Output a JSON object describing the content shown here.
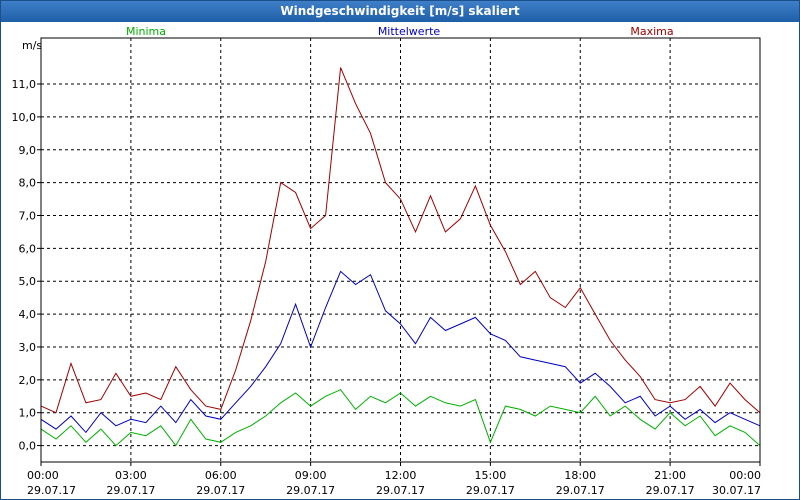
{
  "window": {
    "title": "Windgeschwindigkeit [m/s] skaliert"
  },
  "chart_data": {
    "type": "line",
    "title": "Windgeschwindigkeit [m/s] skaliert",
    "ylabel": "m/s",
    "xlabel": "",
    "ylim": [
      -0.5,
      12.4
    ],
    "xlim": [
      0,
      24
    ],
    "grid": true,
    "legend": "top",
    "y_ticks": [
      0,
      1,
      2,
      3,
      4,
      5,
      6,
      7,
      8,
      9,
      10,
      11
    ],
    "y_tick_labels": [
      "0,0",
      "1,0",
      "2,0",
      "3,0",
      "4,0",
      "5,0",
      "6,0",
      "7,0",
      "8,0",
      "9,0",
      "10,0",
      "11,0"
    ],
    "x_ticks": [
      {
        "x": 0,
        "time": "00:00",
        "date": "29.07.17"
      },
      {
        "x": 3,
        "time": "03:00",
        "date": "29.07.17"
      },
      {
        "x": 6,
        "time": "06:00",
        "date": "29.07.17"
      },
      {
        "x": 9,
        "time": "09:00",
        "date": "29.07.17"
      },
      {
        "x": 12,
        "time": "12:00",
        "date": "29.07.17"
      },
      {
        "x": 15,
        "time": "15:00",
        "date": "29.07.17"
      },
      {
        "x": 18,
        "time": "18:00",
        "date": "29.07.17"
      },
      {
        "x": 21,
        "time": "21:00",
        "date": "29.07.17"
      },
      {
        "x": 24,
        "time": "00:00",
        "date": "30.07.17"
      }
    ],
    "series": [
      {
        "name": "Minima",
        "color": "#00b000",
        "x": [
          0,
          0.5,
          1,
          1.5,
          2,
          2.5,
          3,
          3.5,
          4,
          4.5,
          5,
          5.5,
          6,
          6.5,
          7,
          7.5,
          8,
          8.5,
          9,
          9.5,
          10,
          10.5,
          11,
          11.5,
          12,
          12.5,
          13,
          13.5,
          14,
          14.5,
          15,
          15.5,
          16,
          16.5,
          17,
          17.5,
          18,
          18.5,
          19,
          19.5,
          20,
          20.5,
          21,
          21.5,
          22,
          22.5,
          23,
          23.5,
          24
        ],
        "values": [
          0.5,
          0.2,
          0.6,
          0.1,
          0.5,
          0.0,
          0.4,
          0.3,
          0.6,
          0.0,
          0.8,
          0.2,
          0.1,
          0.4,
          0.6,
          0.9,
          1.3,
          1.6,
          1.2,
          1.5,
          1.7,
          1.1,
          1.5,
          1.3,
          1.6,
          1.2,
          1.5,
          1.3,
          1.2,
          1.4,
          0.1,
          1.2,
          1.1,
          0.9,
          1.2,
          1.1,
          1.0,
          1.5,
          0.9,
          1.2,
          0.8,
          0.5,
          1.0,
          0.6,
          0.9,
          0.3,
          0.6,
          0.4,
          0.0
        ]
      },
      {
        "name": "Mittelwerte",
        "color": "#0000c0",
        "x": [
          0,
          0.5,
          1,
          1.5,
          2,
          2.5,
          3,
          3.5,
          4,
          4.5,
          5,
          5.5,
          6,
          6.5,
          7,
          7.5,
          8,
          8.5,
          9,
          9.5,
          10,
          10.5,
          11,
          11.5,
          12,
          12.5,
          13,
          13.5,
          14,
          14.5,
          15,
          15.5,
          16,
          16.5,
          17,
          17.5,
          18,
          18.5,
          19,
          19.5,
          20,
          20.5,
          21,
          21.5,
          22,
          22.5,
          23,
          23.5,
          24
        ],
        "values": [
          0.8,
          0.5,
          0.9,
          0.4,
          1.0,
          0.6,
          0.8,
          0.7,
          1.2,
          0.7,
          1.4,
          0.9,
          0.8,
          1.3,
          1.8,
          2.4,
          3.1,
          4.3,
          3.0,
          4.2,
          5.3,
          4.9,
          5.2,
          4.1,
          3.7,
          3.1,
          3.9,
          3.5,
          3.7,
          3.9,
          3.4,
          3.2,
          2.7,
          2.6,
          2.5,
          2.4,
          1.9,
          2.2,
          1.8,
          1.3,
          1.5,
          0.9,
          1.2,
          0.8,
          1.1,
          0.7,
          1.0,
          0.8,
          0.6
        ]
      },
      {
        "name": "Maxima",
        "color": "#a00000",
        "x": [
          0,
          0.5,
          1,
          1.5,
          2,
          2.5,
          3,
          3.5,
          4,
          4.5,
          5,
          5.5,
          6,
          6.5,
          7,
          7.5,
          8,
          8.5,
          9,
          9.5,
          10,
          10.5,
          11,
          11.5,
          12,
          12.5,
          13,
          13.5,
          14,
          14.5,
          15,
          15.5,
          16,
          16.5,
          17,
          17.5,
          18,
          18.5,
          19,
          19.5,
          20,
          20.5,
          21,
          21.5,
          22,
          22.5,
          23,
          23.5,
          24
        ],
        "values": [
          1.2,
          1.0,
          2.5,
          1.3,
          1.4,
          2.2,
          1.5,
          1.6,
          1.4,
          2.4,
          1.7,
          1.2,
          1.1,
          2.3,
          3.8,
          5.6,
          8.0,
          7.7,
          6.6,
          7.0,
          11.5,
          10.4,
          9.5,
          8.0,
          7.5,
          6.5,
          7.6,
          6.5,
          6.9,
          7.9,
          6.7,
          5.9,
          4.9,
          5.3,
          4.5,
          4.2,
          4.8,
          4.0,
          3.2,
          2.6,
          2.1,
          1.4,
          1.3,
          1.4,
          1.8,
          1.2,
          1.9,
          1.4,
          1.0
        ]
      }
    ]
  }
}
